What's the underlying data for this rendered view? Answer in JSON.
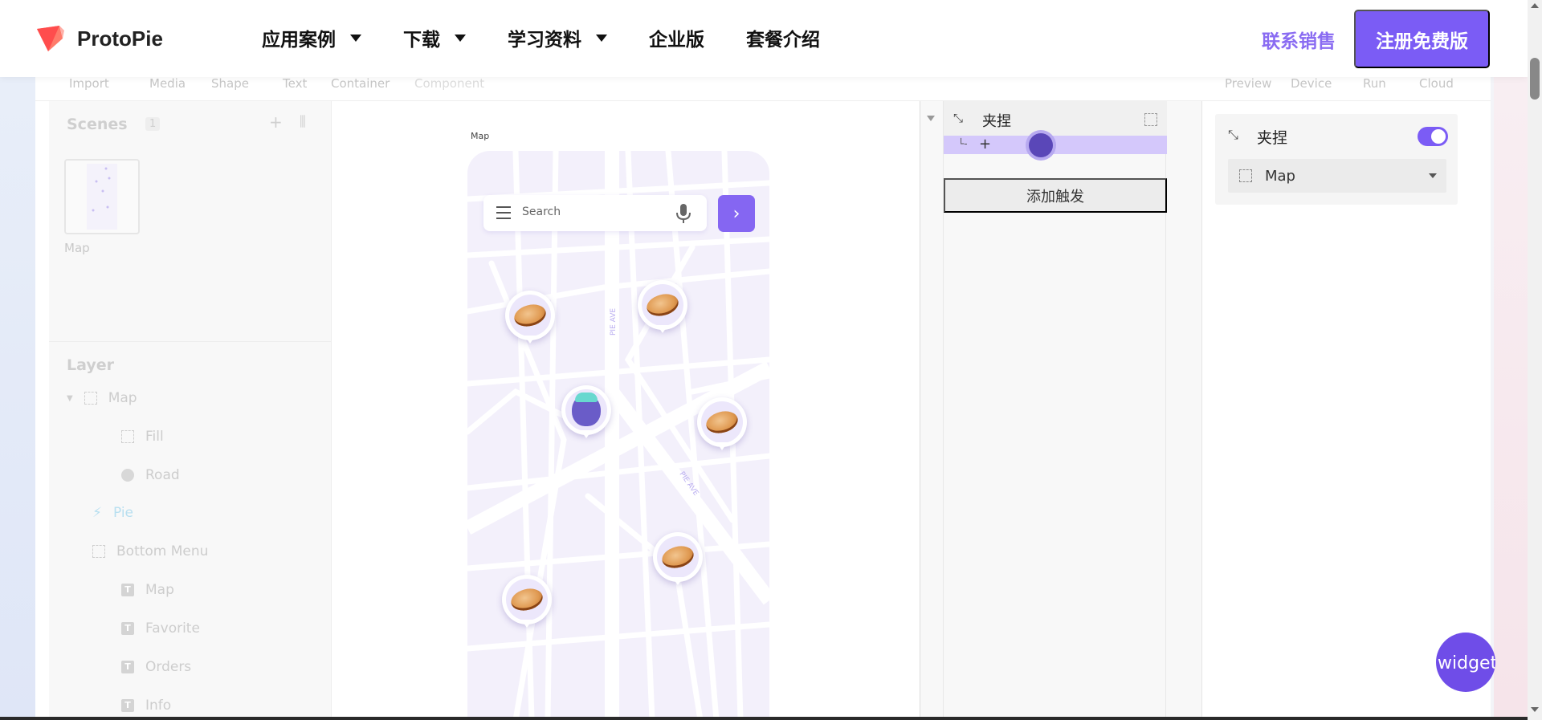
{
  "brand": {
    "name": "ProtoPie"
  },
  "nav": [
    {
      "label": "应用案例",
      "dropdown": true
    },
    {
      "label": "下载",
      "dropdown": true
    },
    {
      "label": "学习资料",
      "dropdown": true
    },
    {
      "label": "企业版",
      "dropdown": false
    },
    {
      "label": "套餐介绍",
      "dropdown": false
    }
  ],
  "header_actions": {
    "contact_label": "联系销售",
    "signup_label": "注册免费版"
  },
  "toolbar": {
    "left": [
      "Import",
      "Media",
      "Shape",
      "Text",
      "Container",
      "Component"
    ],
    "right": [
      "Preview",
      "Device",
      "Run",
      "Cloud"
    ]
  },
  "scenes": {
    "title": "Scenes",
    "count": "1",
    "items": [
      {
        "label": "Map"
      }
    ]
  },
  "layers": {
    "title": "Layer",
    "items": [
      {
        "label": "Map",
        "icon": "frame-icon"
      },
      {
        "label": "Fill",
        "icon": "frame-icon"
      },
      {
        "label": "Road",
        "icon": "dot-icon"
      },
      {
        "label": "Pie",
        "icon": "bolt-icon"
      },
      {
        "label": "Bottom Menu",
        "icon": "frame-icon"
      },
      {
        "label": "Map",
        "icon": "text-icon"
      },
      {
        "label": "Favorite",
        "icon": "text-icon"
      },
      {
        "label": "Orders",
        "icon": "text-icon"
      },
      {
        "label": "Info",
        "icon": "text-icon"
      }
    ]
  },
  "canvas": {
    "scene_label": "Map",
    "search_placeholder": "Search",
    "street_labels": [
      "PIE AVE",
      "PIE AVE"
    ]
  },
  "interaction": {
    "trigger_title": "夹捏",
    "add_trigger_label": "添加触发"
  },
  "properties": {
    "title": "夹捏",
    "enabled": true,
    "layer_value": "Map"
  },
  "widget": {
    "label": "widget"
  },
  "colors": {
    "accent": "#7b5cf5",
    "accent_text": "#8a6cf2",
    "map_bg": "#f3f0fb"
  }
}
